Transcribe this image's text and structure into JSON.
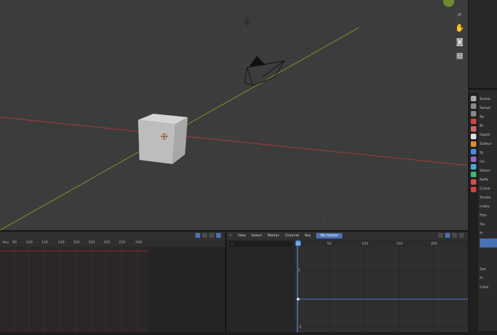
{
  "viewport": {
    "nav_icons": [
      "zoom-icon",
      "hand-icon",
      "camera-icon",
      "grid-icon"
    ],
    "colors": {
      "background": "#3c3c3c",
      "x_axis": "#9b3b3b",
      "y_axis": "#6e8a2e",
      "cube": "#bfbfbf"
    }
  },
  "timeline": {
    "ruler_label": "Key",
    "ticks": [
      "80",
      "100",
      "120",
      "140",
      "160",
      "180",
      "200",
      "220",
      "240"
    ]
  },
  "graph_editor": {
    "menus": [
      "View",
      "Select",
      "Marker",
      "Channel",
      "Key"
    ],
    "mode_label": "No motion",
    "ruler_ticks": [
      "50",
      "100",
      "150",
      "200"
    ],
    "playhead_frame": "50",
    "y_labels": [
      "5",
      "0",
      "-5"
    ]
  },
  "properties": {
    "rows": [
      "Scene",
      "Sampl",
      "Au",
      "Bl",
      "Depth",
      "Subsur",
      "Sc",
      "Un",
      "Volum",
      "Refle",
      "Curve",
      "Shade",
      "Indire",
      "Film",
      "Per",
      "Fr",
      "",
      "",
      "",
      "Gre",
      "Fr",
      "Color"
    ]
  }
}
